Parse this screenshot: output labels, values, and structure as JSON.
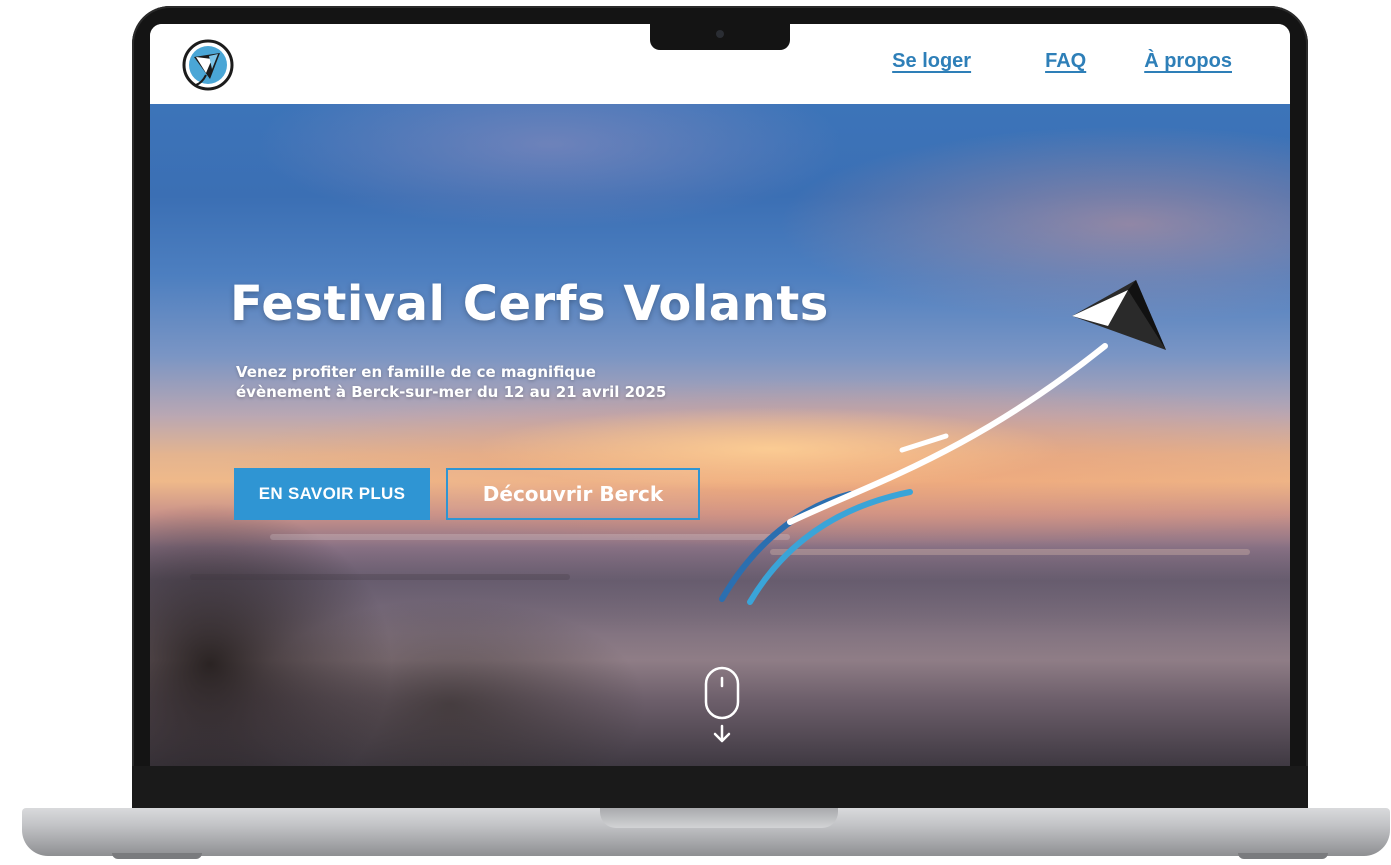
{
  "nav": {
    "logo_icon": "kite-logo-icon",
    "links": [
      {
        "label": "Se loger"
      },
      {
        "label": "FAQ"
      },
      {
        "label": "À propos"
      }
    ]
  },
  "hero": {
    "title": "Festival Cerfs Volants",
    "subtitle_line1": "Venez profiter en famille de ce magnifique",
    "subtitle_line2": "évènement à Berck-sur-mer du 12 au 21 avril 2025",
    "primary_button": "EN SAVOIR PLUS",
    "secondary_button": "Découvrir Berck",
    "scroll_icon": "mouse-scroll-icon"
  },
  "colors": {
    "accent": "#2f95d3",
    "link": "#2e7fb8"
  }
}
